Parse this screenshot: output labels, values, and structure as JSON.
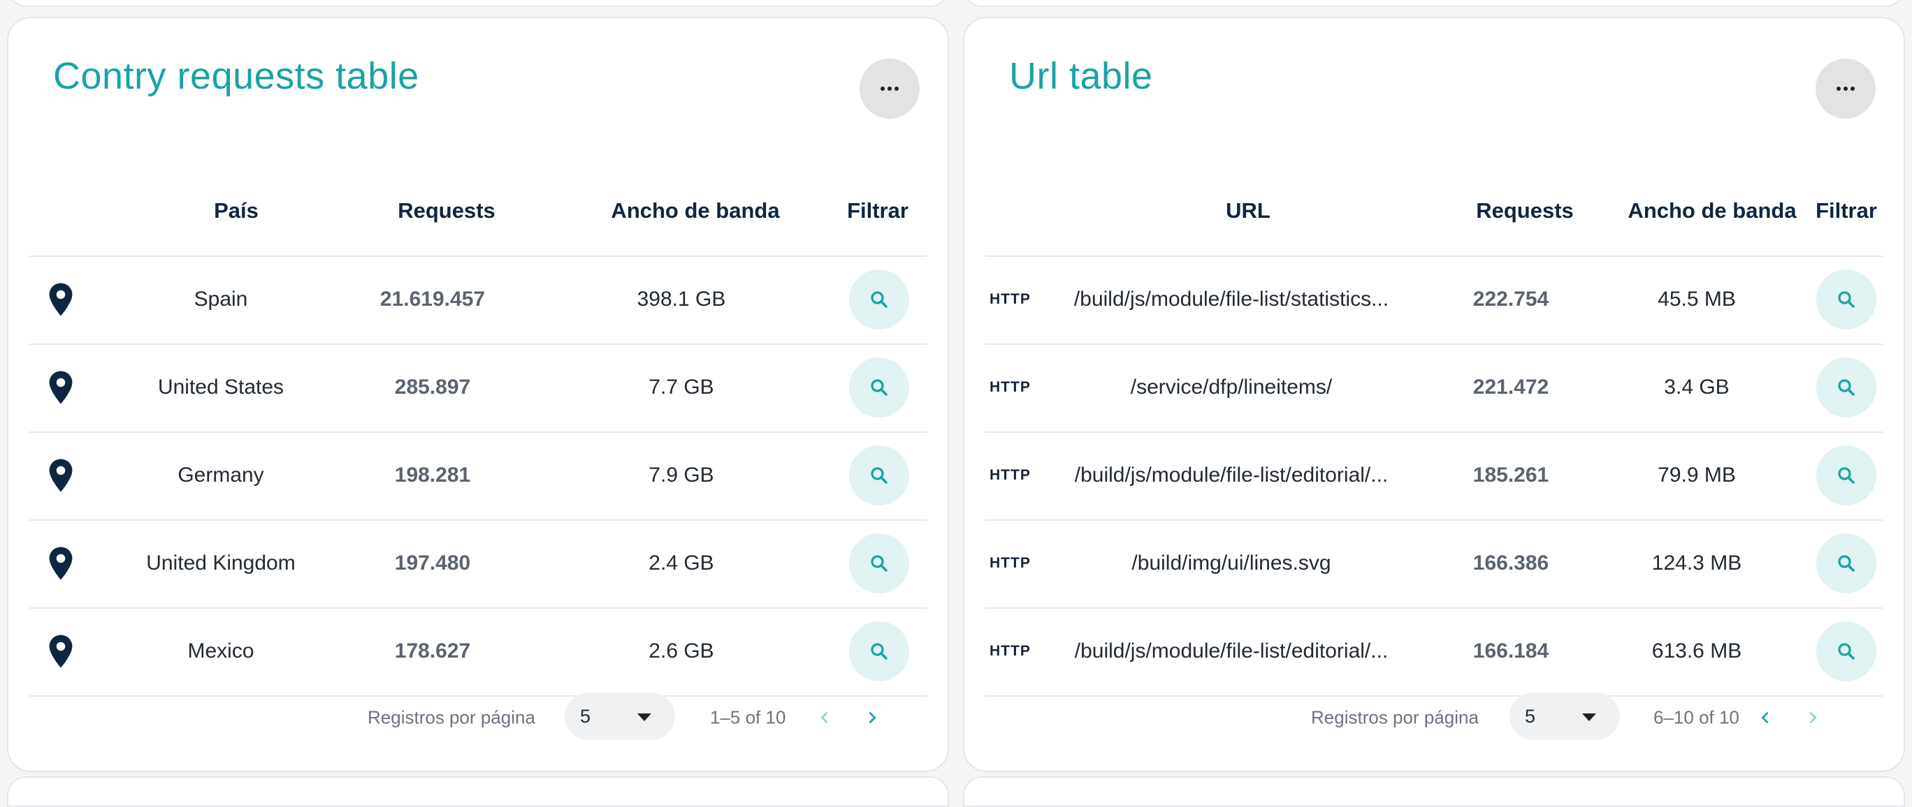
{
  "country_card": {
    "title": "Contry requests table",
    "more_icon": "more-horizontal-icon",
    "headers": {
      "country": "País",
      "requests": "Requests",
      "bandwidth": "Ancho de banda",
      "filter": "Filtrar"
    },
    "rows": [
      {
        "icon": "location-pin-icon",
        "country": "Spain",
        "requests": "21.619.457",
        "bandwidth": "398.1 GB"
      },
      {
        "icon": "location-pin-icon",
        "country": "United States",
        "requests": "285.897",
        "bandwidth": "7.7 GB"
      },
      {
        "icon": "location-pin-icon",
        "country": "Germany",
        "requests": "198.281",
        "bandwidth": "7.9 GB"
      },
      {
        "icon": "location-pin-icon",
        "country": "United Kingdom",
        "requests": "197.480",
        "bandwidth": "2.4 GB"
      },
      {
        "icon": "location-pin-icon",
        "country": "Mexico",
        "requests": "178.627",
        "bandwidth": "2.6 GB"
      }
    ],
    "pagination": {
      "rows_per_page_label": "Registros por página",
      "rows_per_page_value": "5",
      "range": "1–5 of 10"
    }
  },
  "url_card": {
    "title": "Url table",
    "more_icon": "more-horizontal-icon",
    "headers": {
      "url": "URL",
      "requests": "Requests",
      "bandwidth": "Ancho de banda",
      "filter": "Filtrar"
    },
    "rows": [
      {
        "protocol": "HTTP",
        "url": "/build/js/module/file-list/statistics...",
        "requests": "222.754",
        "bandwidth": "45.5 MB"
      },
      {
        "protocol": "HTTP",
        "url": "/service/dfp/lineitems/",
        "requests": "221.472",
        "bandwidth": "3.4 GB"
      },
      {
        "protocol": "HTTP",
        "url": "/build/js/module/file-list/editorial/...",
        "requests": "185.261",
        "bandwidth": "79.9 MB"
      },
      {
        "protocol": "HTTP",
        "url": "/build/img/ui/lines.svg",
        "requests": "166.386",
        "bandwidth": "124.3 MB"
      },
      {
        "protocol": "HTTP",
        "url": "/build/js/module/file-list/editorial/...",
        "requests": "166.184",
        "bandwidth": "613.6 MB"
      }
    ],
    "pagination": {
      "rows_per_page_label": "Registros por página",
      "rows_per_page_value": "5",
      "range": "6–10 of 10"
    }
  },
  "colors": {
    "accent": "#1aa3a5",
    "accent_bg": "#e1f3f3",
    "heading": "#0f2640",
    "nav_disabled": "#8fd2d3"
  }
}
